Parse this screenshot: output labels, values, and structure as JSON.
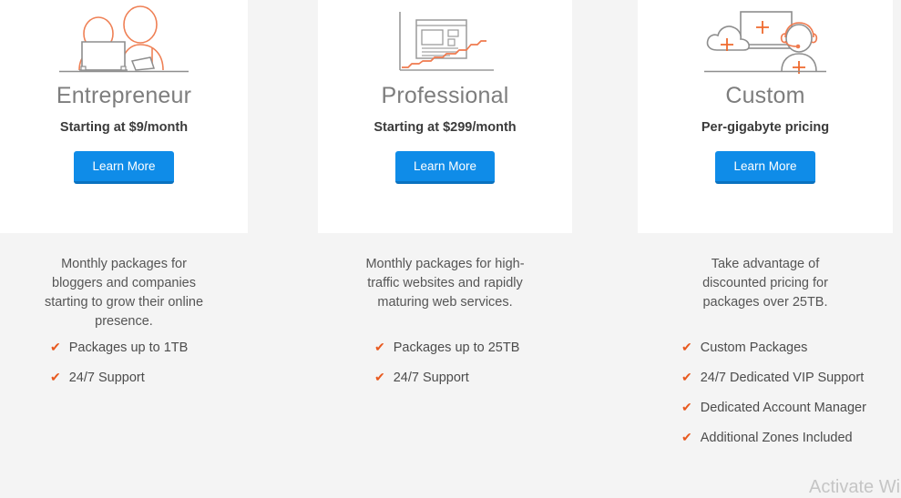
{
  "plans": [
    {
      "id": "entrepreneur",
      "title": "Entrepreneur",
      "price": "Starting at $9/month",
      "cta": "Learn More",
      "illustration": "people-laptop-illustration",
      "description": "Monthly packages for bloggers and companies starting to grow their online presence.",
      "features": [
        "Packages up to 1TB",
        "24/7 Support"
      ]
    },
    {
      "id": "professional",
      "title": "Professional",
      "price": "Starting at $299/month",
      "cta": "Learn More",
      "illustration": "website-growth-chart-illustration",
      "description": "Monthly packages for high-traffic websites and rapidly maturing web services.",
      "features": [
        "Packages up to 25TB",
        "24/7 Support"
      ]
    },
    {
      "id": "custom",
      "title": "Custom",
      "price": "Per-gigabyte pricing",
      "cta": "Learn More",
      "illustration": "cloud-support-illustration",
      "description": "Take advantage of discounted pricing for packages over 25TB.",
      "features": [
        "Custom Packages",
        "24/7 Dedicated VIP Support",
        "Dedicated Account Manager",
        "Additional Zones Included"
      ]
    }
  ],
  "check_glyph": "✔",
  "watermark": "Activate Wi",
  "colors": {
    "page_background": "#f4f4f4",
    "card_background": "#ffffff",
    "button": "#0f8ce8",
    "button_shadow": "#0a72c0",
    "check": "#e8591f",
    "title": "#7d7d7d",
    "body_text": "#555555",
    "illustration_orange": "#ef8055",
    "illustration_gray": "#9a9a9a"
  }
}
